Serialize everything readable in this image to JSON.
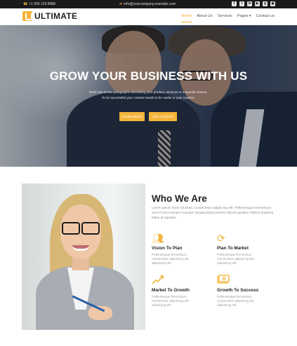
{
  "topbar": {
    "phone": "+1 555 123 8888",
    "email": "info@yourcompany.example.com",
    "social_icons": [
      "facebook-icon",
      "twitter-icon",
      "linkedin-icon",
      "youtube-icon",
      "google-plus-icon",
      "github-icon"
    ]
  },
  "brand": {
    "name": "ULTIMATE",
    "accent": "#f5b53a"
  },
  "nav": {
    "items": [
      {
        "label": "Home",
        "active": true
      },
      {
        "label": "About Us"
      },
      {
        "label": "Services"
      },
      {
        "label": "Pages ▾"
      },
      {
        "label": "Contact us"
      }
    ]
  },
  "hero": {
    "title": "GROW YOUR BUSINESS WITH US",
    "subtitle_line1": "Write one or two paragraphs describing your product, services or a specific feature.",
    "subtitle_line2": "To be successful your content needs to be useful to your readers.",
    "button_primary": "LEARN MORE",
    "button_secondary": "GET A QUOTE"
  },
  "about": {
    "title": "Who We Are",
    "text": "Lorem ipsum dolor sit amet, consectetur adipiscing elit. Pellentesque fermentum sed id tortor tempor suscipit. Suspendisse potenti ultrices porttitor finibus pharetra tellus at egestas.",
    "features": [
      {
        "icon": "people-icon",
        "title": "Vision To Plan",
        "text": "Pellentesque fermentum consectetur adipiscing elit. adipiscing elit."
      },
      {
        "icon": "refresh-icon",
        "title": "Plan To Market",
        "text": "Pellentesque fermentum consectetur adipiscing elit. adipiscing elit."
      },
      {
        "icon": "growth-chart-icon",
        "title": "Market To Growth",
        "text": "Pellentesque fermentum consectetur adipiscing elit. adipiscing elit."
      },
      {
        "icon": "money-icon",
        "title": "Growth To Success",
        "text": "Pellentesque fermentum consectetur adipiscing elit. adipiscing elit."
      }
    ]
  }
}
